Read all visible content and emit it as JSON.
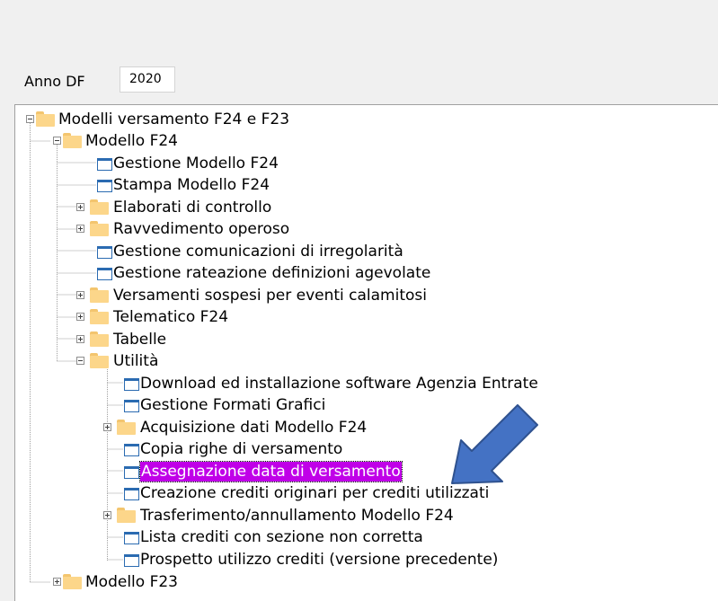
{
  "filter": {
    "anno_label": "Anno DF",
    "anno_value": "2020"
  },
  "tree": {
    "selection_color": "#c000e8",
    "nodes": [
      {
        "label": "Modelli versamento F24 e F23",
        "type": "folder",
        "expander": "minus"
      },
      {
        "label": "Modello F24",
        "type": "folder",
        "expander": "minus"
      },
      {
        "label": "Gestione Modello F24",
        "type": "page"
      },
      {
        "label": "Stampa Modello F24",
        "type": "page"
      },
      {
        "label": "Elaborati di controllo",
        "type": "folder",
        "expander": "plus"
      },
      {
        "label": "Ravvedimento operoso",
        "type": "folder",
        "expander": "plus"
      },
      {
        "label": "Gestione comunicazioni di irregolarità",
        "type": "page"
      },
      {
        "label": "Gestione rateazione definizioni agevolate",
        "type": "page"
      },
      {
        "label": "Versamenti sospesi per eventi calamitosi",
        "type": "folder",
        "expander": "plus"
      },
      {
        "label": "Telematico F24",
        "type": "folder",
        "expander": "plus"
      },
      {
        "label": "Tabelle",
        "type": "folder",
        "expander": "plus"
      },
      {
        "label": "Utilità",
        "type": "folder",
        "expander": "minus"
      },
      {
        "label": "Download ed installazione software Agenzia Entrate",
        "type": "page"
      },
      {
        "label": "Gestione Formati Grafici",
        "type": "page"
      },
      {
        "label": "Acquisizione dati Modello F24",
        "type": "folder",
        "expander": "plus"
      },
      {
        "label": "Copia righe di versamento",
        "type": "page"
      },
      {
        "label": "Assegnazione data di versamento",
        "type": "page",
        "selected": true
      },
      {
        "label": "Creazione crediti originari per crediti utilizzati",
        "type": "page"
      },
      {
        "label": "Trasferimento/annullamento Modello F24",
        "type": "folder",
        "expander": "plus"
      },
      {
        "label": "Lista crediti con sezione non corretta",
        "type": "page"
      },
      {
        "label": "Prospetto utilizzo crediti (versione precedente)",
        "type": "page"
      },
      {
        "label": "Modello F23",
        "type": "folder",
        "expander": "plus"
      }
    ]
  },
  "annotation": {
    "arrow_color": "#4472c4",
    "arrow_border": "#2f528f"
  }
}
